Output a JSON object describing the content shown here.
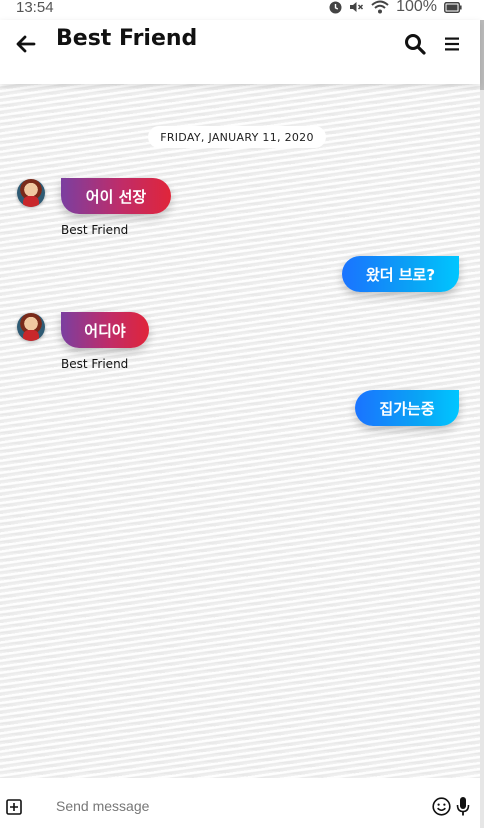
{
  "status_bar": {
    "time": "13:54",
    "battery_percent": "100%",
    "icons": [
      "alarm-icon",
      "mute-icon",
      "wifi-icon",
      "battery-icon"
    ]
  },
  "header": {
    "title": "Best Friend",
    "icons": [
      "back-arrow-icon",
      "search-icon",
      "menu-icon"
    ]
  },
  "chat": {
    "date_label": "FRIDAY, JANUARY 11, 2020",
    "messages": [
      {
        "direction": "incoming",
        "text": "어이 선장",
        "sender": "Best Friend"
      },
      {
        "direction": "outgoing",
        "text": "왔더 브로?"
      },
      {
        "direction": "incoming",
        "text": "어디야",
        "sender": "Best Friend"
      },
      {
        "direction": "outgoing",
        "text": "집가는중"
      }
    ]
  },
  "input_bar": {
    "placeholder": "Send message",
    "value": "",
    "icons": [
      "add-icon",
      "emoji-icon",
      "microphone-icon"
    ]
  },
  "colors": {
    "incoming_gradient": [
      "#7b3fa0",
      "#e0253a"
    ],
    "outgoing_gradient": [
      "#1a73ff",
      "#00c6ff"
    ],
    "header_bg": "#ffffff",
    "chat_bg": "#f2f2f2"
  }
}
